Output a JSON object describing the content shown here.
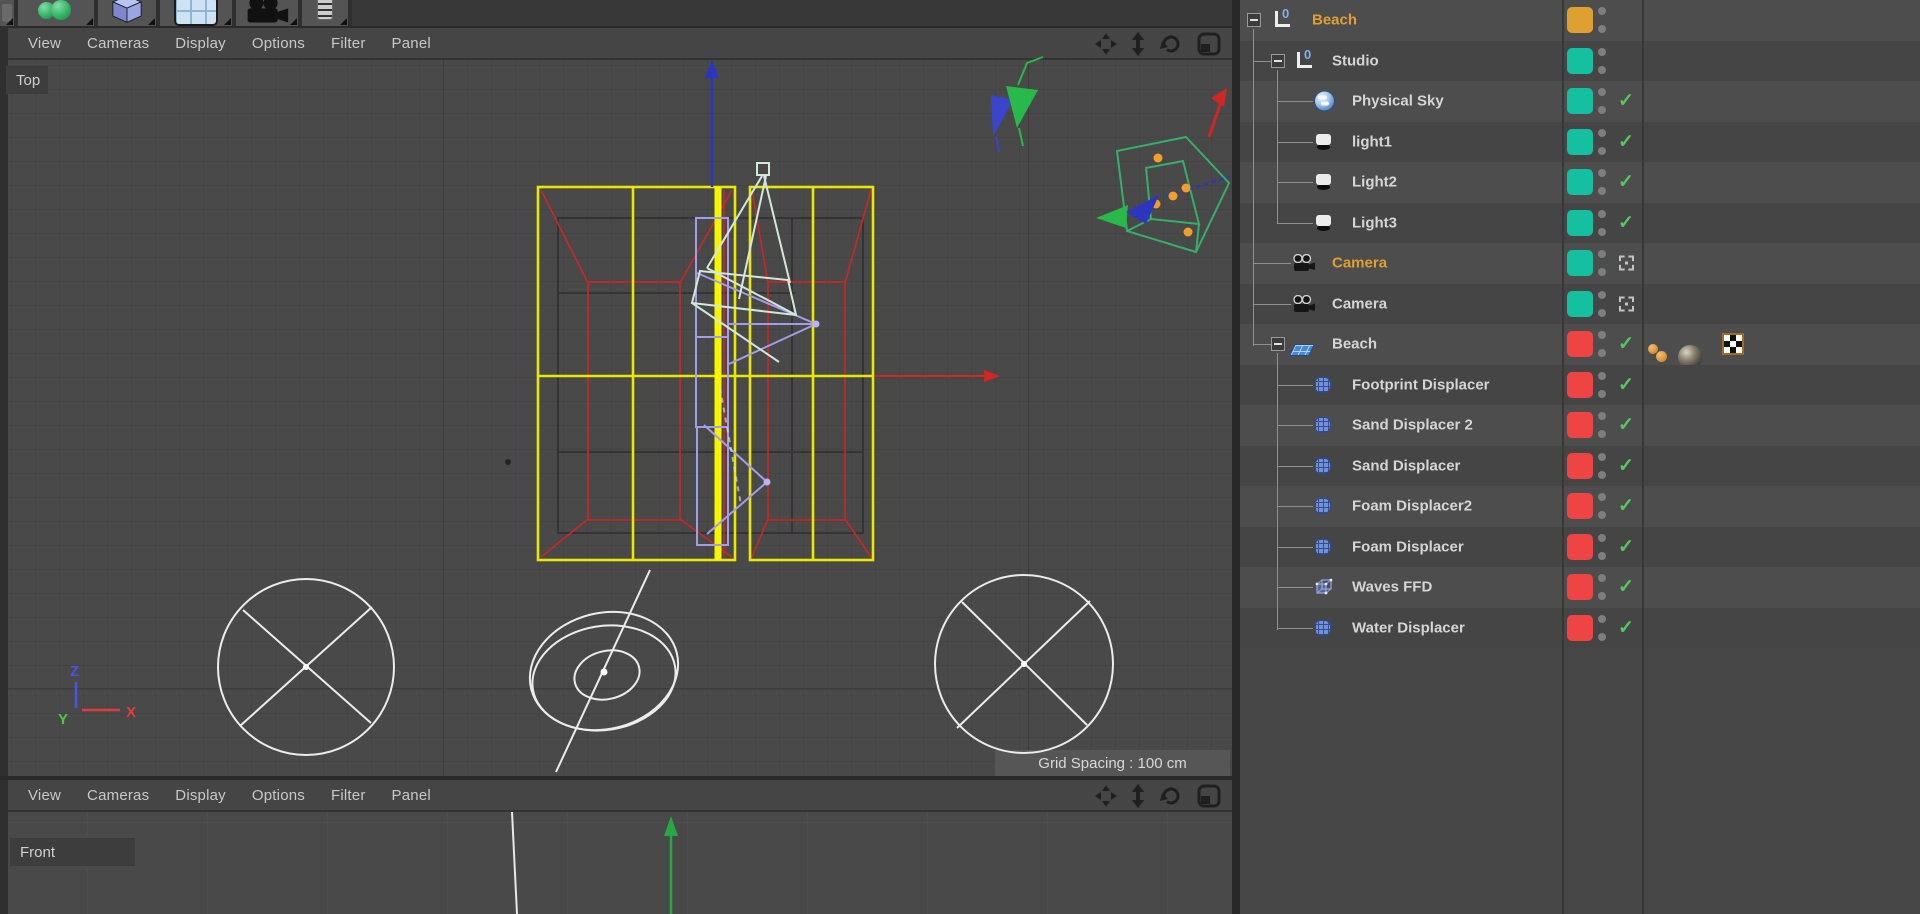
{
  "toolbar": {
    "tools": [
      "partial-tool-icon",
      "selection-spheres-tool-icon",
      "cube-primitive-tool-icon",
      "viewport-layout-tool-icon",
      "camera-tool-icon",
      "list-tool-icon"
    ]
  },
  "viewport_menus": {
    "items": [
      "View",
      "Cameras",
      "Display",
      "Options",
      "Filter",
      "Panel"
    ],
    "nav_icons": [
      "pan-view-icon",
      "zoom-view-icon",
      "rotate-view-icon",
      "toggle-panel-icon"
    ]
  },
  "viewport_top": {
    "label": "Top",
    "grid_spacing": "Grid Spacing : 100 cm",
    "axis_labels": [
      "Z",
      "Y",
      "X"
    ]
  },
  "viewport_front": {
    "label": "Front"
  },
  "object_manager": {
    "rows": [
      {
        "label": "Beach",
        "level": 1,
        "icon": "null",
        "swatch": "orange",
        "selected": true,
        "expander": true,
        "visibility": "none"
      },
      {
        "label": "Studio",
        "level": 2,
        "icon": "null",
        "swatch": "teal",
        "expander": true,
        "visibility": "none"
      },
      {
        "label": "Physical Sky",
        "level": 3,
        "icon": "physical-sky",
        "swatch": "teal",
        "visibility": "check"
      },
      {
        "label": "light1",
        "level": 3,
        "icon": "light",
        "swatch": "teal",
        "visibility": "check"
      },
      {
        "label": "Light2",
        "level": 3,
        "icon": "light",
        "swatch": "teal",
        "visibility": "check"
      },
      {
        "label": "Light3",
        "level": 3,
        "icon": "light",
        "swatch": "teal",
        "visibility": "check"
      },
      {
        "label": "Camera",
        "level": 2,
        "icon": "camera",
        "swatch": "teal",
        "selected": true,
        "visibility": "render-target"
      },
      {
        "label": "Camera",
        "level": 2,
        "icon": "camera",
        "swatch": "teal",
        "visibility": "render-target"
      },
      {
        "label": "Beach",
        "level": 2,
        "icon": "plane",
        "swatch": "red",
        "expander": true,
        "visibility": "check",
        "tags": [
          "phong-tag",
          "material-thumbnail",
          "compositing-tag"
        ]
      },
      {
        "label": "Footprint Displacer",
        "level": 3,
        "icon": "displacer",
        "swatch": "red",
        "visibility": "check"
      },
      {
        "label": "Sand Displacer 2",
        "level": 3,
        "icon": "displacer",
        "swatch": "red",
        "visibility": "check"
      },
      {
        "label": "Sand Displacer",
        "level": 3,
        "icon": "displacer",
        "swatch": "red",
        "visibility": "check"
      },
      {
        "label": "Foam Displacer2",
        "level": 3,
        "icon": "displacer",
        "swatch": "red",
        "visibility": "check"
      },
      {
        "label": "Foam Displacer",
        "level": 3,
        "icon": "displacer",
        "swatch": "red",
        "visibility": "check"
      },
      {
        "label": "Waves FFD",
        "level": 3,
        "icon": "ffd",
        "swatch": "red",
        "visibility": "check"
      },
      {
        "label": "Water Displacer",
        "level": 3,
        "icon": "displacer",
        "swatch": "red",
        "visibility": "check"
      }
    ]
  },
  "colors": {
    "accent_selected": "#dfa032",
    "swatch_orange": "#dfa032",
    "swatch_teal": "#14c0a0",
    "swatch_red": "#ef4444",
    "check_green": "#55c95f",
    "wire_yellow": "#e8e800",
    "wire_red": "#cc2626",
    "wire_lavender": "#a29de8",
    "wire_mint": "#d2e8da",
    "wire_camera_green": "#35b06a",
    "axis_blue": "#2b35c0",
    "axis_red": "#d22626",
    "axis_green": "#28a844"
  }
}
